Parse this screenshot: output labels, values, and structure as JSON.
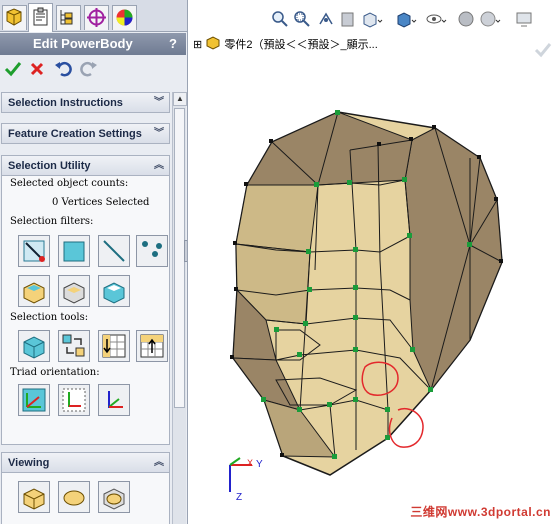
{
  "property_manager": {
    "title": "Edit PowerBody",
    "help": "?",
    "ok_icon": "check-icon",
    "cancel_icon": "x-icon",
    "undo_icon": "undo-icon",
    "redo_icon": "redo-icon"
  },
  "groups": {
    "selection_instructions": "Selection Instructions",
    "feature_creation": "Feature Creation Settings",
    "selection_utility": "Selection Utility",
    "viewing": "Viewing"
  },
  "selection_utility": {
    "counts_label": "Selected object counts:",
    "counts_value": "0 Vertices Selected",
    "filters_label": "Selection filters:",
    "tools_label": "Selection tools:",
    "triad_label": "Triad orientation:"
  },
  "feature_tree": {
    "expand": "⊞",
    "text": "零件2（預設＜＜預設＞_顯示..."
  },
  "triad": {
    "x": "X",
    "y": "Y",
    "z": "Z"
  },
  "watermark": "三维网www.3dportal.cn",
  "colors": {
    "face": "#e6d3a0",
    "face_dark": "#9a8566",
    "edge": "#1b1b1b",
    "vertex": "#1a9c3a",
    "markup": "#e3282c"
  }
}
